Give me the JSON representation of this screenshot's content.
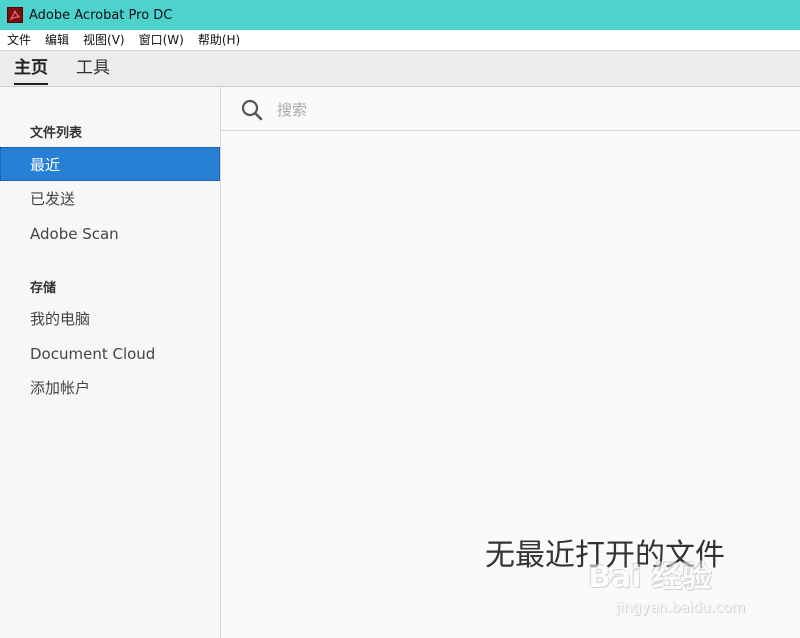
{
  "window": {
    "title": "Adobe Acrobat Pro DC"
  },
  "menubar": {
    "items": [
      "文件",
      "编辑",
      "视图(V)",
      "窗口(W)",
      "帮助(H)"
    ]
  },
  "tabs": {
    "home": "主页",
    "tools": "工具"
  },
  "sidebar": {
    "file_list_title": "文件列表",
    "file_items": [
      "最近",
      "已发送",
      "Adobe Scan"
    ],
    "storage_title": "存储",
    "storage_items": [
      "我的电脑",
      "Document Cloud",
      "添加帐户"
    ],
    "active_item": "最近"
  },
  "search": {
    "placeholder": "搜索",
    "value": ""
  },
  "main": {
    "empty_message": "无最近打开的文件"
  },
  "watermark": {
    "logo_text": "Bai 经验",
    "url": "jingyan.baidu.com"
  },
  "colors": {
    "titlebar": "#4dd2cd",
    "active_item": "#2680d5",
    "brand_icon": "#7a0f12"
  },
  "icons": {
    "app": "acrobat-logo-icon",
    "search": "search-icon"
  }
}
